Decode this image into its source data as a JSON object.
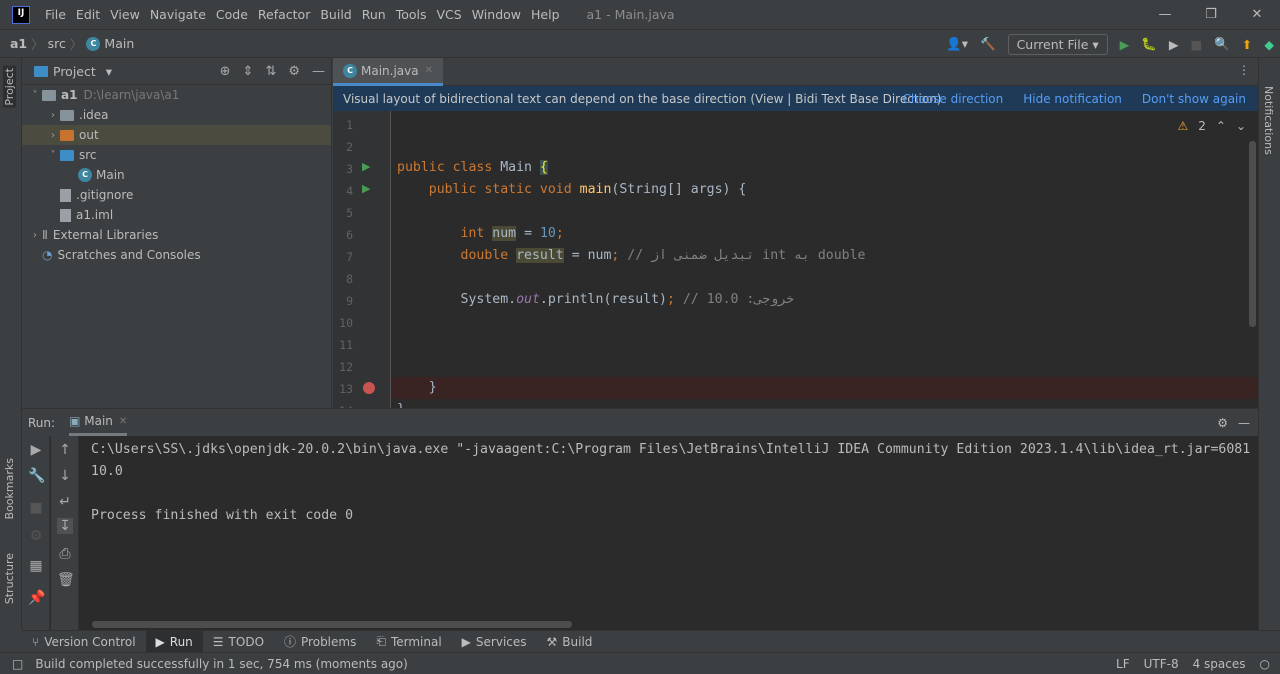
{
  "app": {
    "logo": "IJ",
    "window_title": "a1 - Main.java",
    "menu": [
      "File",
      "Edit",
      "View",
      "Navigate",
      "Code",
      "Refactor",
      "Build",
      "Run",
      "Tools",
      "VCS",
      "Window",
      "Help"
    ]
  },
  "breadcrumb": [
    "a1",
    "src",
    "Main"
  ],
  "toolbar": {
    "run_config": "Current File"
  },
  "project": {
    "title": "Project",
    "tree": [
      {
        "label": "a1",
        "path": "D:\\learn\\java\\a1",
        "depth": 0,
        "expanded": true,
        "kind": "module"
      },
      {
        "label": ".idea",
        "depth": 1,
        "expanded": false,
        "kind": "folder"
      },
      {
        "label": "out",
        "depth": 1,
        "expanded": false,
        "kind": "folder-orange",
        "selected": true
      },
      {
        "label": "src",
        "depth": 1,
        "expanded": true,
        "kind": "folder-blue"
      },
      {
        "label": "Main",
        "depth": 2,
        "kind": "class"
      },
      {
        "label": ".gitignore",
        "depth": 1,
        "kind": "file"
      },
      {
        "label": "a1.iml",
        "depth": 1,
        "kind": "file"
      },
      {
        "label": "External Libraries",
        "depth": 0,
        "expanded": false,
        "kind": "lib"
      },
      {
        "label": "Scratches and Consoles",
        "depth": 0,
        "kind": "scratch"
      }
    ]
  },
  "editor": {
    "tab": "Main.java",
    "notification": {
      "text": "Visual layout of bidirectional text can depend on the base direction (View | Bidi Text Base Direction)",
      "actions": [
        "Choose direction",
        "Hide notification",
        "Don't show again"
      ]
    },
    "warnings": "2",
    "lines": [
      [],
      [],
      [
        {
          "t": "public class ",
          "c": "kw"
        },
        {
          "t": "Main ",
          "c": ""
        },
        {
          "t": "{",
          "c": "br"
        }
      ],
      [
        {
          "t": "    public static void ",
          "c": "kw"
        },
        {
          "t": "main",
          "c": "fn"
        },
        {
          "t": "(String[] args) {",
          "c": ""
        }
      ],
      [],
      [
        {
          "t": "        ",
          "c": ""
        },
        {
          "t": "int ",
          "c": "kw"
        },
        {
          "t": "num",
          "c": "hl"
        },
        {
          "t": " = ",
          "c": ""
        },
        {
          "t": "10",
          "c": "num"
        },
        {
          "t": ";",
          "c": "kw"
        }
      ],
      [
        {
          "t": "        ",
          "c": ""
        },
        {
          "t": "double ",
          "c": "kw"
        },
        {
          "t": "result",
          "c": "hl"
        },
        {
          "t": " = num",
          "c": ""
        },
        {
          "t": "; ",
          "c": "kw"
        },
        {
          "t": "// تبدیل ضمنی از int به double",
          "c": "cm"
        }
      ],
      [],
      [
        {
          "t": "        System.",
          "c": ""
        },
        {
          "t": "out",
          "c": "it"
        },
        {
          "t": ".println(result)",
          "c": ""
        },
        {
          "t": "; ",
          "c": "kw"
        },
        {
          "t": "// خروجی: 10.0",
          "c": "cm"
        }
      ],
      [],
      [],
      [],
      [
        {
          "t": "    }",
          "c": ""
        }
      ],
      [
        {
          "t": "}",
          "c": ""
        }
      ]
    ]
  },
  "run": {
    "label": "Run:",
    "tab": "Main",
    "output": [
      "C:\\Users\\SS\\.jdks\\openjdk-20.0.2\\bin\\java.exe \"-javaagent:C:\\Program Files\\JetBrains\\IntelliJ IDEA Community Edition 2023.1.4\\lib\\idea_rt.jar=6081",
      "10.0",
      "",
      "Process finished with exit code 0"
    ]
  },
  "side": {
    "left": [
      "Project",
      "Bookmarks",
      "Structure"
    ],
    "right": "Notifications"
  },
  "bottom_tabs": [
    "Version Control",
    "Run",
    "TODO",
    "Problems",
    "Terminal",
    "Services",
    "Build"
  ],
  "status": {
    "message": "Build completed successfully in 1 sec, 754 ms (moments ago)",
    "line_sep": "LF",
    "encoding": "UTF-8",
    "indent": "4 spaces"
  }
}
